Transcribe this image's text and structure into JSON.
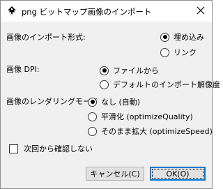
{
  "window": {
    "title": "png ビットマップ画像のインポート"
  },
  "import_type": {
    "label": "画像のインポート形式:",
    "options": [
      {
        "label": "埋め込み",
        "selected": true
      },
      {
        "label": "リンク",
        "selected": false
      }
    ]
  },
  "dpi": {
    "label": "画像 DPI:",
    "options": [
      {
        "label": "ファイルから",
        "selected": true
      },
      {
        "label": "デフォルトのインポート解像度",
        "selected": false
      }
    ]
  },
  "rendering": {
    "label": "画像のレンダリングモード",
    "options": [
      {
        "label": "なし (自動)",
        "selected": true
      },
      {
        "label": "平滑化 (optimizeQuality)",
        "selected": false
      },
      {
        "label": "そのまま拡大 (optimizeSpeed)",
        "selected": false
      }
    ]
  },
  "dont_ask": {
    "label": "次回から確認しない",
    "checked": false
  },
  "buttons": {
    "cancel": "キャンセル(C)",
    "ok": "OK(O)"
  },
  "colors": {
    "dialog_bg": "#f0f0f0",
    "title_bg": "#ffffff",
    "button_bg": "#e1e1e1",
    "default_button_border": "#0078d7"
  }
}
